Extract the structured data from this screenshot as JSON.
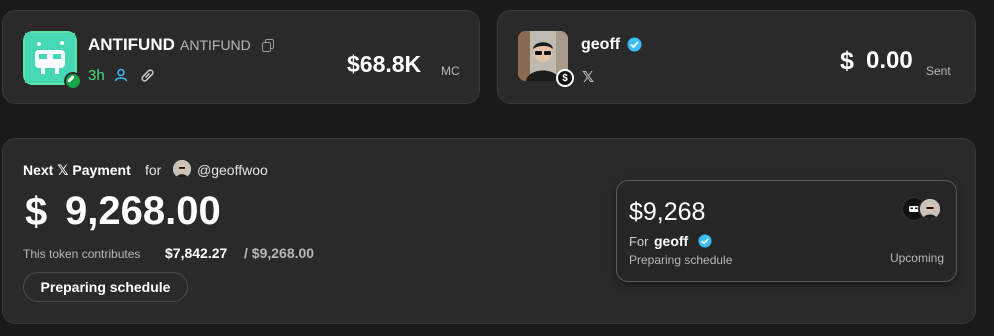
{
  "token": {
    "name": "ANTIFUND",
    "ticker": "ANTIFUND",
    "age": "3h",
    "market_cap": "$68.8K",
    "market_cap_label": "MC",
    "icons": [
      "copy-icon",
      "user-icon",
      "link-icon"
    ]
  },
  "creator": {
    "name": "geoff",
    "verified": true,
    "social": "𝕏",
    "sent_value": "0.00",
    "sent_label": "Sent",
    "currency_symbol": "$"
  },
  "payment": {
    "title": "Next 𝕏 Payment",
    "for_label": "for",
    "handle": "@geoffwoo",
    "currency_symbol": "$",
    "amount": "9,268.00",
    "contrib_label": "This token contributes",
    "contrib_value": "$7,842.27",
    "contrib_total": "/ $9,268.00",
    "schedule_button": "Preparing schedule"
  },
  "upcoming": {
    "amount": "$9,268",
    "for_label": "For",
    "name": "geoff",
    "status": "Preparing schedule",
    "label": "Upcoming"
  },
  "colors": {
    "background": "#1a1a1a",
    "card": "#2a2a2a",
    "green_accent": "#4ade80",
    "verified_blue": "#38bdf8"
  }
}
